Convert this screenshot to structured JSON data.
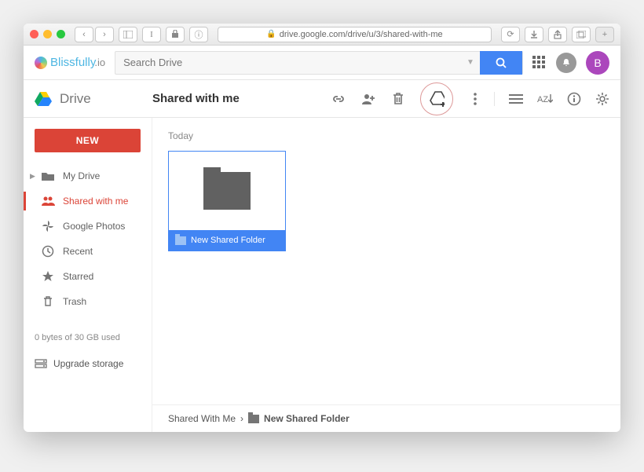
{
  "browser": {
    "url": "drive.google.com/drive/u/3/shared-with-me"
  },
  "brand": {
    "name1": "Blissfully",
    "name2": ".io",
    "search_placeholder": "Search Drive",
    "avatar_initial": "B"
  },
  "drive": {
    "app_name": "Drive",
    "page_title": "Shared with me"
  },
  "sidebar": {
    "new_label": "NEW",
    "items": [
      {
        "label": "My Drive"
      },
      {
        "label": "Shared with me"
      },
      {
        "label": "Google Photos"
      },
      {
        "label": "Recent"
      },
      {
        "label": "Starred"
      },
      {
        "label": "Trash"
      }
    ],
    "storage_text": "0 bytes of 30 GB used",
    "upgrade_label": "Upgrade storage"
  },
  "content": {
    "section": "Today",
    "folder_name": "New Shared Folder"
  },
  "breadcrumb": {
    "root": "Shared With Me",
    "sep": "›",
    "current": "New Shared Folder"
  }
}
